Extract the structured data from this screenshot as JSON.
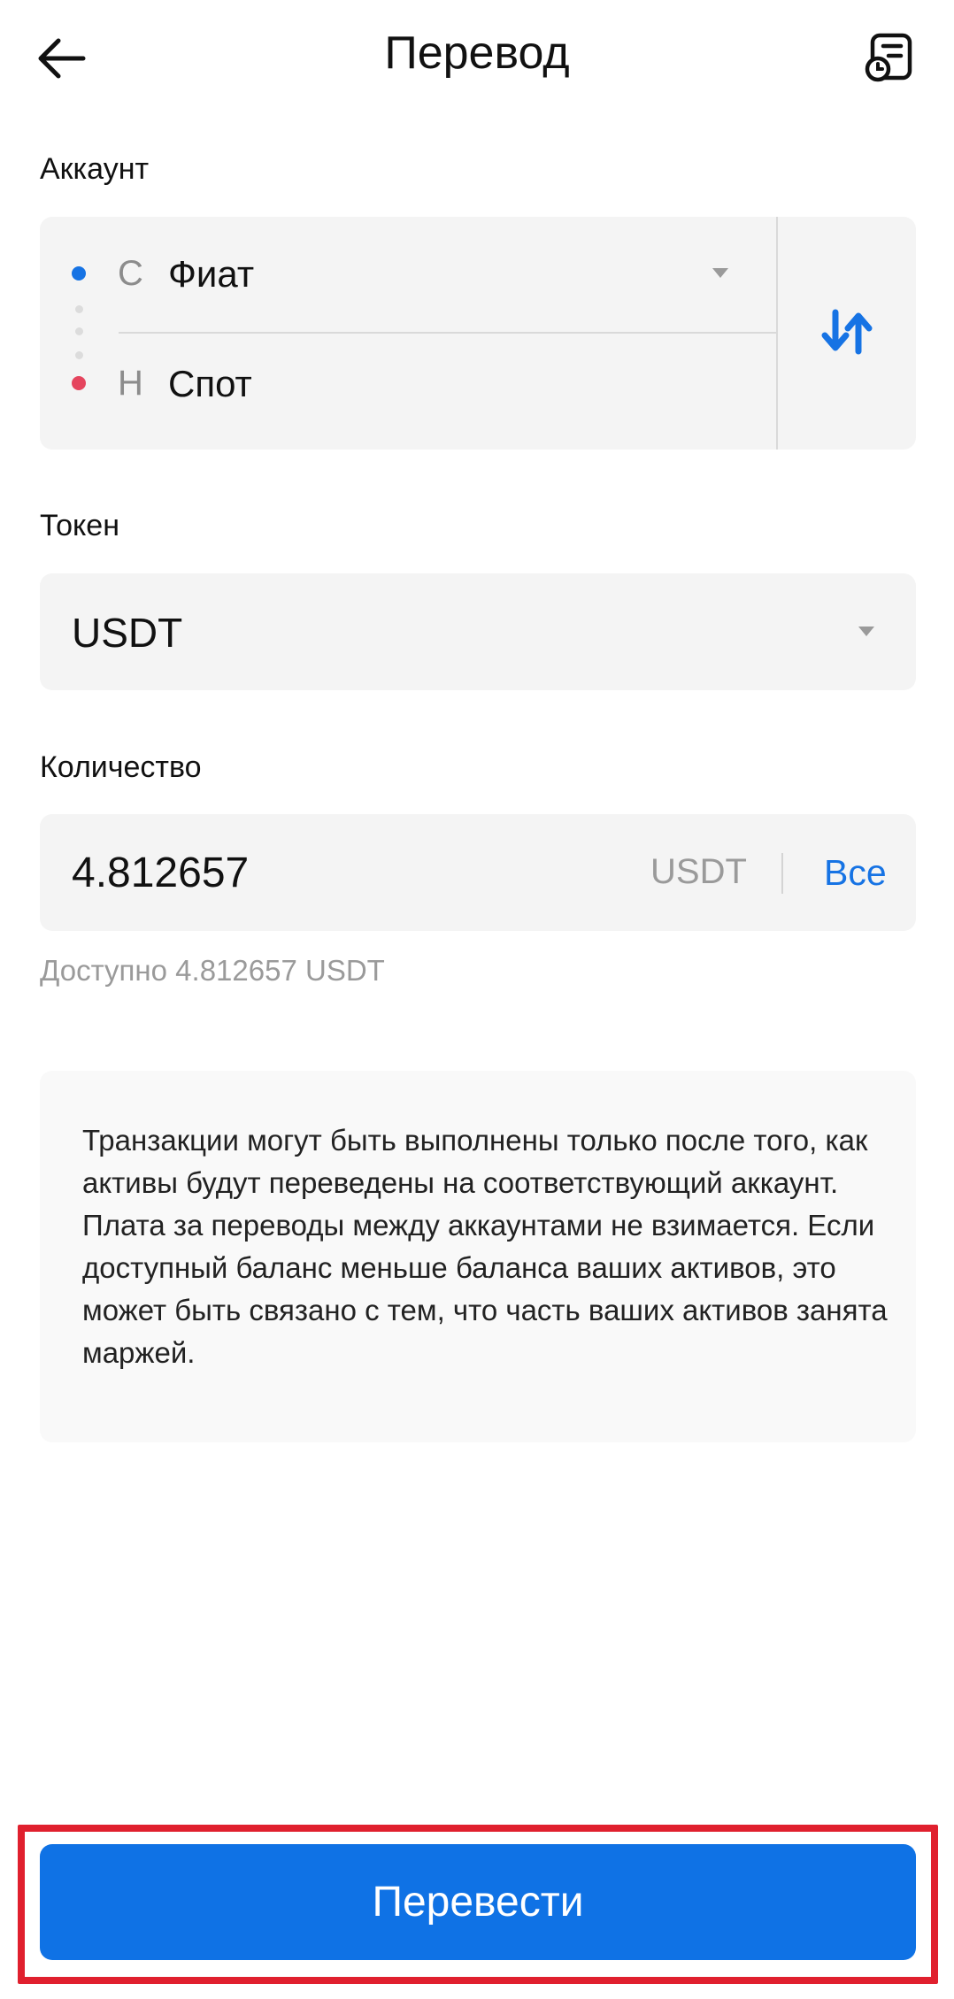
{
  "header": {
    "title": "Перевод",
    "back_icon": "arrow-left-icon",
    "history_icon": "history-list-icon"
  },
  "account": {
    "label": "Аккаунт",
    "from": {
      "prefix": "С",
      "value": "Фиат",
      "dot_color": "#1673e4"
    },
    "to": {
      "prefix": "Н",
      "value": "Спот",
      "dot_color": "#e5455e"
    },
    "swap_icon": "swap-arrows-icon"
  },
  "token": {
    "label": "Токен",
    "value": "USDT"
  },
  "amount": {
    "label": "Количество",
    "value": "4.812657",
    "unit": "USDT",
    "all_label": "Все",
    "available_text": "Доступно 4.812657 USDT"
  },
  "info": {
    "text": "Транзакции могут быть выполнены только после того, как активы будут переведены на соответствующий аккаунт. Плата за переводы между аккаунтами не взимается. Если доступный баланс меньше баланса ваших активов, это может быть связано с тем, что часть ваших активов занята маржей."
  },
  "submit": {
    "label": "Перевести"
  },
  "colors": {
    "accent": "#0f72e5",
    "link": "#1673e4",
    "highlight": "#e0202e"
  }
}
